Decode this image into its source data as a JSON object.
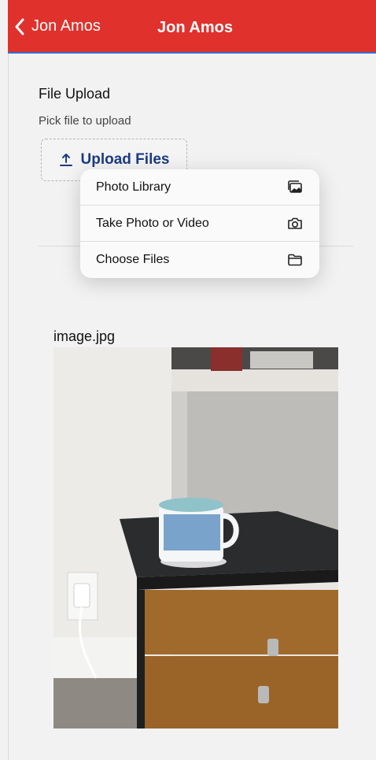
{
  "nav": {
    "back_label": "Jon Amos",
    "title": "Jon Amos"
  },
  "upload": {
    "title": "File Upload",
    "hint": "Pick file to upload",
    "button_label": "Upload Files"
  },
  "menu": {
    "items": [
      {
        "label": "Photo Library",
        "icon": "photo-library-icon"
      },
      {
        "label": "Take Photo or Video",
        "icon": "camera-icon"
      },
      {
        "label": "Choose Files",
        "icon": "folder-icon"
      }
    ]
  },
  "attachment": {
    "file_name": "image.jpg"
  },
  "colors": {
    "nav_bg": "#e0312c",
    "accent": "#1b3c84"
  }
}
